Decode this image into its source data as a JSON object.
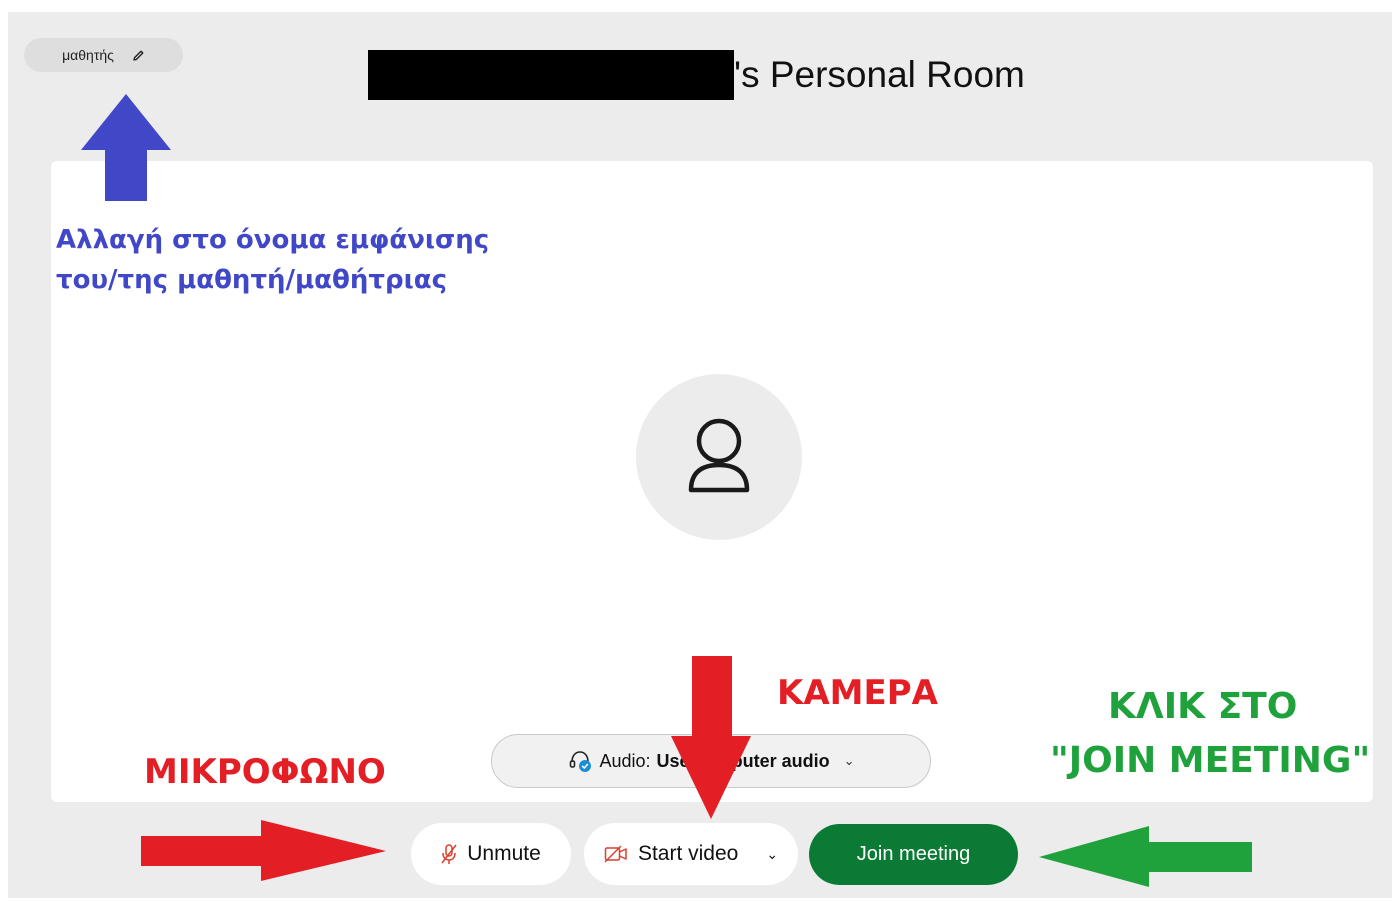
{
  "meeting": {
    "display_name": "μαθητής",
    "room_title_suffix": "'s Personal Room",
    "audio_label": "Audio:",
    "audio_value": "Use computer audio",
    "unmute_label": "Unmute",
    "start_video_label": "Start video",
    "join_label": "Join meeting"
  },
  "annotations": {
    "name_change_line1": "Αλλαγή στο όνομα εμφάνισης",
    "name_change_line2": "του/της μαθητή/μαθήτριας",
    "microphone": "ΜΙΚΡΟΦΩΝΟ",
    "camera": "ΚΑΜΕΡΑ",
    "click_join_line1": "ΚΛΙΚ ΣΤΟ",
    "click_join_line2": "\"JOIN MEETING\""
  },
  "icons": {
    "edit": "pencil-icon",
    "avatar": "user-icon",
    "headset": "headset-icon",
    "mic_muted": "microphone-off-icon",
    "video_off": "video-off-icon",
    "dropdown": "chevron-down-icon"
  },
  "colors": {
    "join_button": "#0a7a35",
    "annotation_blue": "#4148c8",
    "annotation_red": "#e41e25",
    "annotation_green": "#1fa23c",
    "muted_icon": "#d9412b"
  }
}
